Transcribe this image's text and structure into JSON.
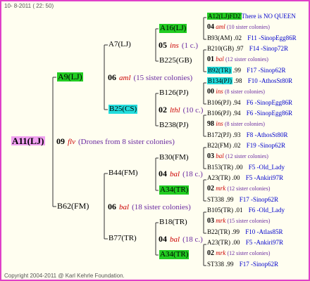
{
  "header": {
    "date": "10- 8-2011 ( 22: 50)"
  },
  "footer": {
    "copyright": "Copyright 2004-2011 @ Karl Kehrle Foundation."
  },
  "root": {
    "name": "A11(LJ)",
    "year": "09",
    "breed": "flv",
    "note": "(Drones from 8 sister colonies)"
  },
  "gen1": {
    "top": {
      "name": "A9(LJ)",
      "year": "06",
      "breed": "aml",
      "note": "(15 sister colonies)"
    },
    "bottom": {
      "name": "B62(FM)",
      "year": "06",
      "breed": "bal",
      "note": "(18 sister colonies)"
    }
  },
  "gen2": [
    {
      "name": "A7(LJ)",
      "year": "05",
      "breed": "ins",
      "note": "(1 c.)"
    },
    {
      "name": "B25(CS)",
      "year": "02",
      "breed": "lthl",
      "note": "(10 c.)"
    },
    {
      "name": "B44(FM)",
      "year": "04",
      "breed": "bal",
      "note": "(18 c.)"
    },
    {
      "name": "B77(TR)",
      "year": "04",
      "breed": "bal",
      "note": "(18 c.)"
    }
  ],
  "gen3": [
    {
      "name": "A16(LJ)"
    },
    {
      "name": "B225(GB)"
    },
    {
      "name": "B126(PJ)"
    },
    {
      "name": "B238(PJ)"
    },
    {
      "name": "B30(FM)",
      "year": "04",
      "breed": "bal",
      "note": "(18 c.)"
    },
    {
      "name": "A34(TR)"
    },
    {
      "name": "B18(TR)"
    },
    {
      "name": "A34(TR)"
    }
  ],
  "leaves": [
    {
      "name": "A12(LJ)FD2",
      "tail": "There is NO QUEEN"
    },
    {
      "text": "04",
      "breed": "aml",
      "note": "(10 sister colonies)"
    },
    {
      "name": "B93(AM)",
      "val": ".02",
      "code": "F11 -SinopEgg86R"
    },
    {
      "name": "B210(GB)",
      "val": ".97",
      "code": "F14 -Sinop72R"
    },
    {
      "text": "01",
      "breed": "bal",
      "note": "(12 sister colonies)"
    },
    {
      "name": "B92(TR)",
      "val": ".99",
      "code": "F17 -Sinop62R"
    },
    {
      "name": "B134(PJ)",
      "val": ".98",
      "code": "F10 -AthosSt80R"
    },
    {
      "text": "00",
      "breed": "ins",
      "note": "(8 sister colonies)"
    },
    {
      "name": "B106(PJ)",
      "val": ".94",
      "code": "F6 -SinopEgg86R"
    },
    {
      "name": "B106(PJ)",
      "val": ".94",
      "code": "F6 -SinopEgg86R"
    },
    {
      "text": "98",
      "breed": "ins",
      "note": "(8 sister colonies)"
    },
    {
      "name": "B172(PJ)",
      "val": ".93",
      "code": "F8 -AthosSt80R"
    },
    {
      "name": "B22(FM)",
      "val": ".02",
      "code": "F19 -Sinop62R"
    },
    {
      "text": "03",
      "breed": "bal",
      "note": "(12 sister colonies)"
    },
    {
      "name": "B153(TR)",
      "val": ".00",
      "code": "F5 -Old_Lady"
    },
    {
      "name": "A23(TR)",
      "val": ".00",
      "code": "F5 -Ankiri97R"
    },
    {
      "text": "02",
      "breed": "mrk",
      "note": "(12 sister colonies)"
    },
    {
      "name": "ST338",
      "val": ".99",
      "code": "F17 -Sinop62R"
    },
    {
      "name": "B105(TR)",
      "val": ".01",
      "code": "F6 -Old_Lady"
    },
    {
      "text": "03",
      "breed": "mrk",
      "note": "(15 sister colonies)"
    },
    {
      "name": "B22(TR)",
      "val": ".99",
      "code": "F10 -Atlas85R"
    },
    {
      "name": "A23(TR)",
      "val": ".00",
      "code": "F5 -Ankiri97R"
    },
    {
      "text": "02",
      "breed": "mrk",
      "note": "(12 sister colonies)"
    },
    {
      "name": "ST338",
      "val": ".99",
      "code": "F17 -Sinop62R"
    }
  ]
}
